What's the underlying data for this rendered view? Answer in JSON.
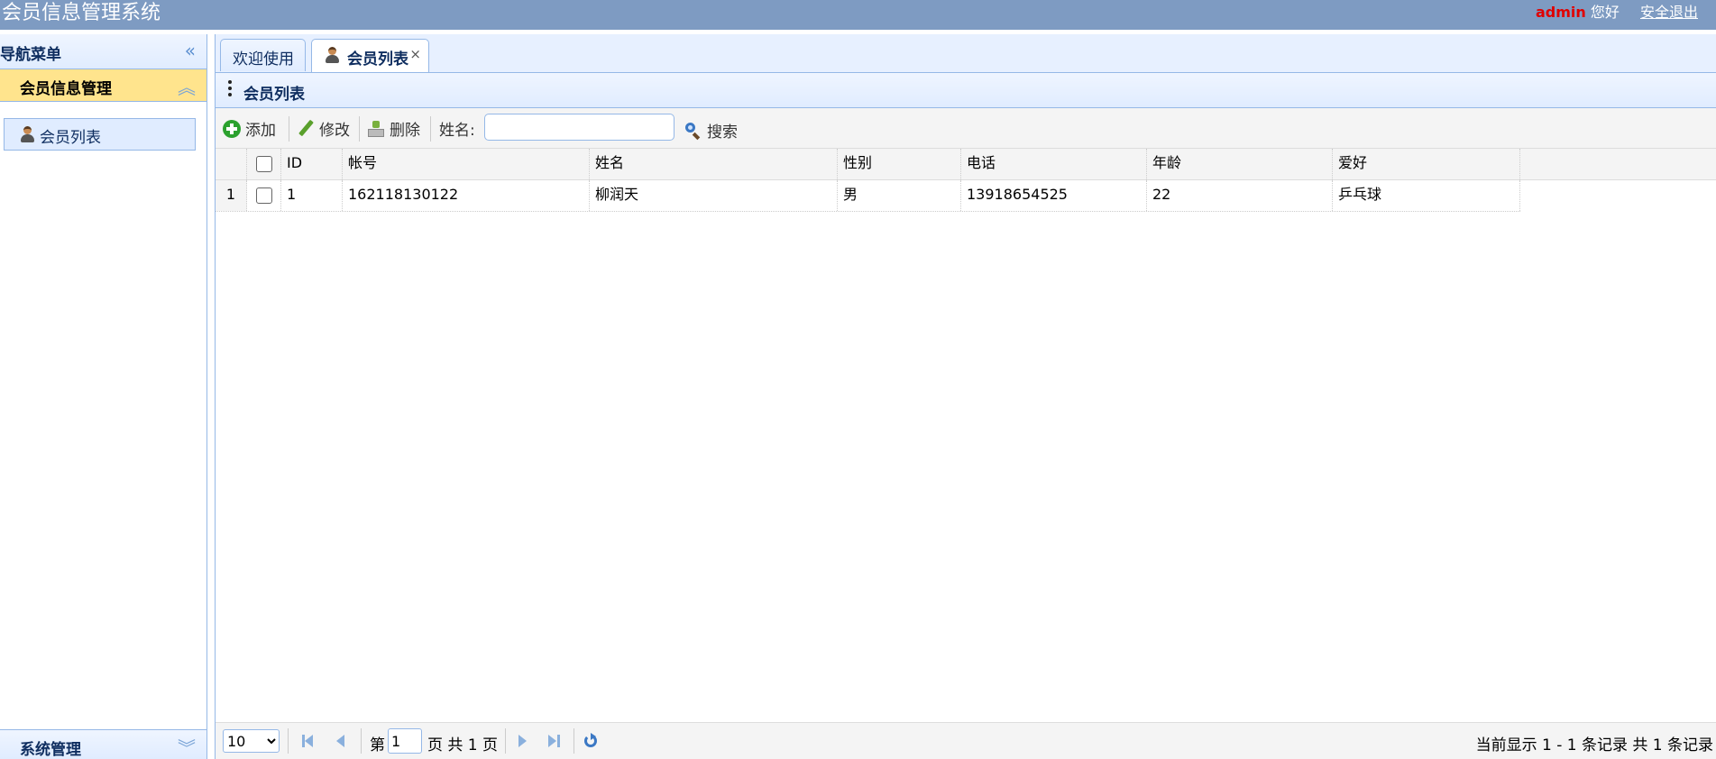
{
  "header": {
    "title": "会员信息管理系统",
    "user": "admin",
    "greeting": "您好",
    "logout": "安全退出"
  },
  "sidebar": {
    "title": "导航菜单",
    "groups": [
      {
        "label": "会员信息管理",
        "items": [
          {
            "label": "会员列表"
          }
        ]
      },
      {
        "label": "系统管理"
      }
    ]
  },
  "tabs": [
    {
      "label": "欢迎使用"
    },
    {
      "label": "会员列表",
      "close": "×"
    }
  ],
  "panel": {
    "title": "会员列表"
  },
  "toolbar": {
    "add": "添加",
    "edit": "修改",
    "delete": "删除",
    "search_label": "姓名:",
    "search_value": "",
    "search": "搜索"
  },
  "grid": {
    "columns": [
      "ID",
      "帐号",
      "姓名",
      "性别",
      "电话",
      "年龄",
      "爱好"
    ],
    "rows": [
      {
        "rownum": "1",
        "cells": [
          "1",
          "162118130122",
          "柳润天",
          "男",
          "13918654525",
          "22",
          "乒乓球"
        ]
      }
    ]
  },
  "pager": {
    "page_size": "10",
    "page_prefix": "第",
    "page": "1",
    "page_suffix": "页 共 1 页",
    "info": "当前显示 1 - 1 条记录 共 1 条记录"
  },
  "colors": {
    "header_bg": "#7e9bc2",
    "accent_border": "#95b8e7",
    "selected_group": "#ffe48d",
    "user_name": "#e00000"
  }
}
